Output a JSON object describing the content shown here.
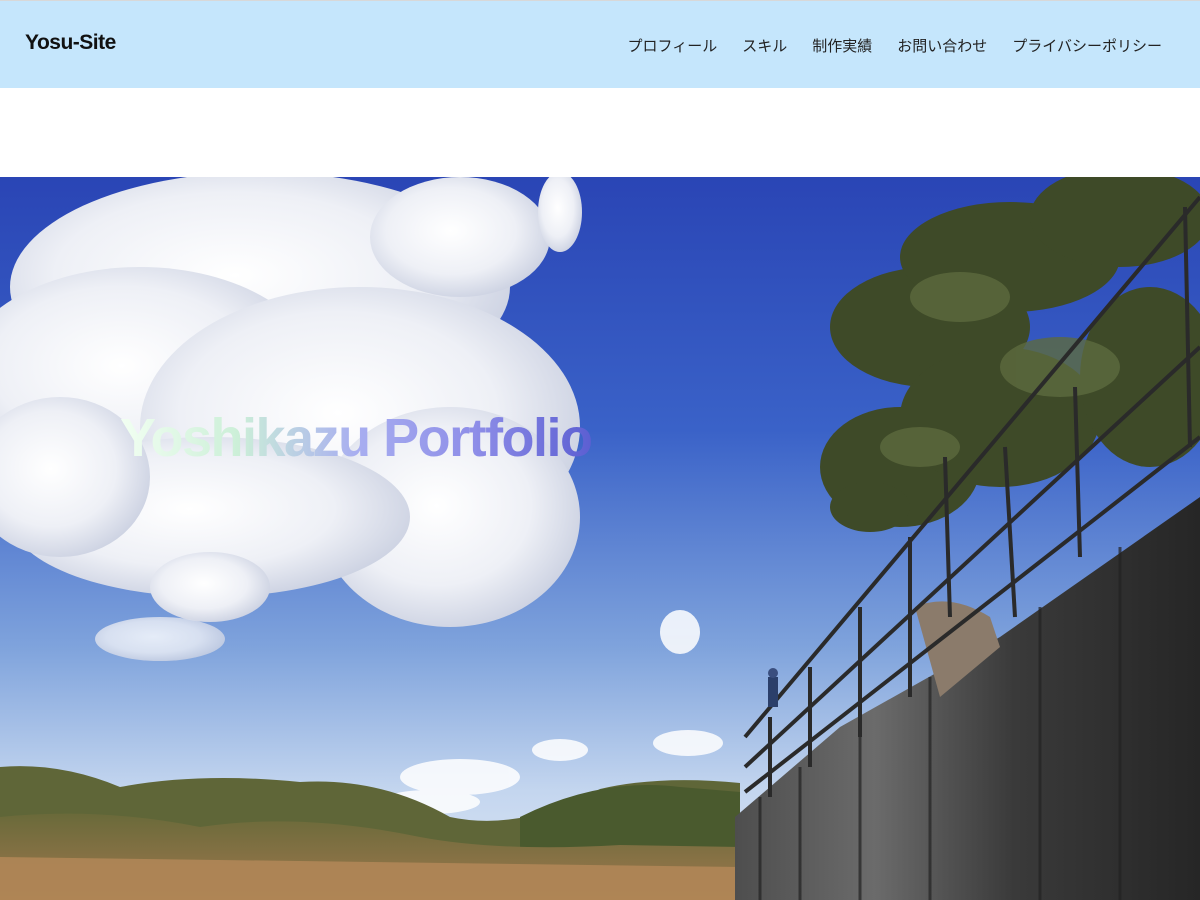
{
  "site": {
    "logo": "Yosu-Site"
  },
  "nav": {
    "items": [
      "プロフィール",
      "スキル",
      "制作実績",
      "お問い合わせ",
      "プライバシーポリシー"
    ]
  },
  "hero": {
    "title": "Yoshikazu Portfolio"
  },
  "colors": {
    "header_bg": "#c5e6fc",
    "sky_top": "#2c49b8",
    "sky_bottom": "#c3d5ee"
  }
}
